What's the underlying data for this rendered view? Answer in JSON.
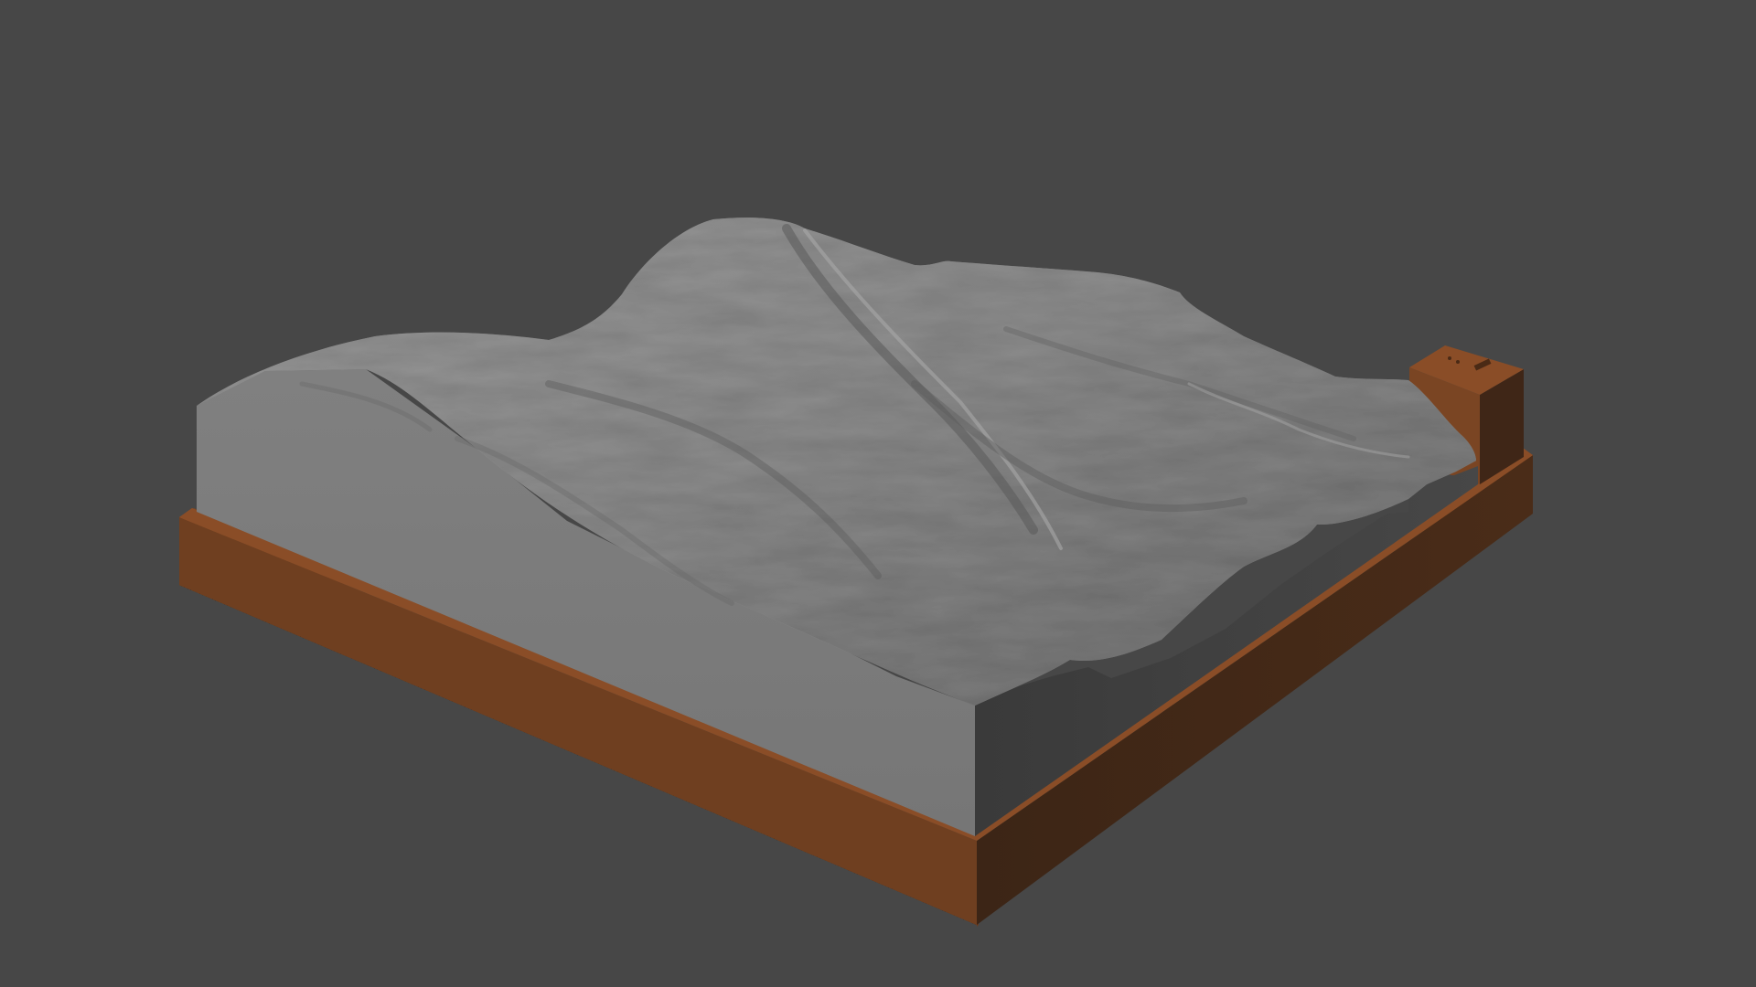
{
  "viewport": {
    "background_color": "#474747"
  },
  "scene": {
    "object": "terrain-relief-model",
    "terrain_color": "#8a8a8a",
    "block_side_color": "#7b7b7b",
    "block_shadow_side_color": "#3d3d3d",
    "base_top_color": "#8a4d27",
    "base_front_color": "#6f3f20",
    "base_side_color": "#3a2416",
    "tab_color": "#6b3d22"
  }
}
